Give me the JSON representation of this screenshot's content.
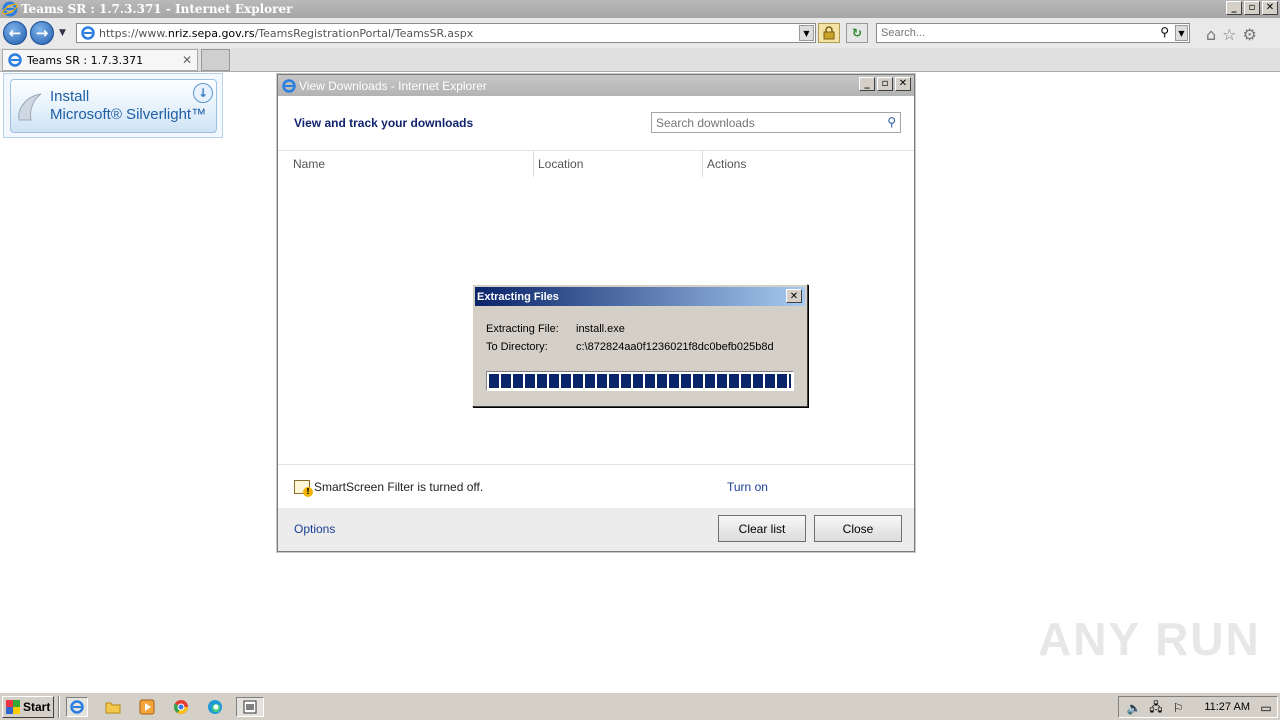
{
  "window": {
    "title": "Teams SR : 1.7.3.371 - Internet Explorer",
    "min": "_",
    "max": "▫",
    "close": "✕"
  },
  "nav": {
    "back": "←",
    "forward": "→",
    "url_prefix": "https://www.",
    "url_domain": "nriz.sepa.gov.rs",
    "url_path": "/TeamsRegistrationPortal/TeamsSR.aspx",
    "search_placeholder": "Search..."
  },
  "tabs": [
    {
      "label": "Teams SR : 1.7.3.371"
    }
  ],
  "silverlight": {
    "line1": "Install",
    "line2": "Microsoft® Silverlight™"
  },
  "downloads": {
    "title": "View Downloads - Internet Explorer",
    "heading": "View and track your downloads",
    "search_placeholder": "Search downloads",
    "columns": [
      "Name",
      "Location",
      "Actions"
    ],
    "smartscreen": "SmartScreen Filter is turned off.",
    "turn_on": "Turn on",
    "options": "Options",
    "clear_list": "Clear list",
    "close": "Close"
  },
  "extract": {
    "title": "Extracting Files",
    "file_label": "Extracting File:",
    "file_value": "install.exe",
    "dir_label": "To Directory:",
    "dir_value": "c:\\872824aa0f1236021f8dc0befb025b8d",
    "progress": 1.0
  },
  "watermark": "ANY RUN",
  "taskbar": {
    "start": "Start",
    "clock": "11:27 AM"
  }
}
